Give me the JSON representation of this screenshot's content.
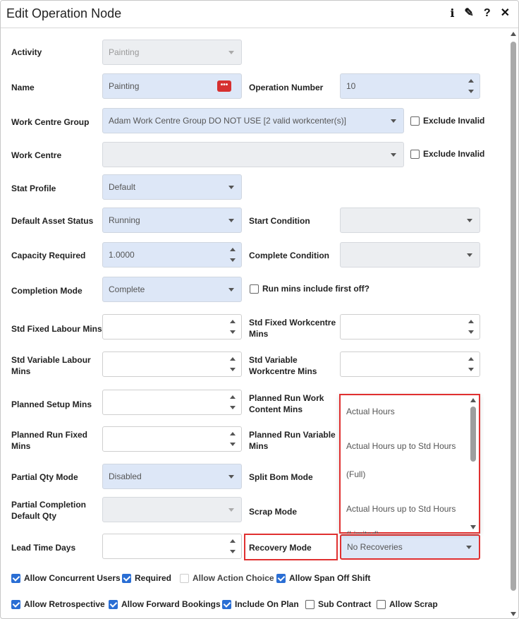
{
  "dialog": {
    "title": "Edit Operation Node",
    "icons": [
      "info-icon",
      "pencil-icon",
      "help-icon",
      "close-icon"
    ],
    "icon_glyphs": {
      "info": "i",
      "edit": "✎",
      "help": "?",
      "close": "✕"
    }
  },
  "form": {
    "activity": {
      "label": "Activity",
      "value": "Painting"
    },
    "name": {
      "label": "Name",
      "value": "Painting",
      "button": "•••"
    },
    "operation_number": {
      "label": "Operation Number",
      "value": "10"
    },
    "work_centre_group": {
      "label": "Work Centre Group",
      "value": "Adam Work Centre Group DO NOT USE [2 valid workcenter(s)]",
      "exclude_label": "Exclude Invalid"
    },
    "work_centre": {
      "label": "Work Centre",
      "value": "",
      "exclude_label": "Exclude Invalid"
    },
    "stat_profile": {
      "label": "Stat Profile",
      "value": "Default"
    },
    "default_asset_status": {
      "label": "Default Asset Status",
      "value": "Running"
    },
    "start_condition": {
      "label": "Start Condition",
      "value": ""
    },
    "capacity_required": {
      "label": "Capacity Required",
      "value": "1.0000"
    },
    "complete_condition": {
      "label": "Complete Condition",
      "value": ""
    },
    "completion_mode": {
      "label": "Completion Mode",
      "value": "Complete"
    },
    "run_mins_first_off": {
      "label": "Run mins include first off?"
    },
    "std_fixed_labour_mins": {
      "label": "Std Fixed Labour Mins",
      "value": ""
    },
    "std_fixed_workcentre_mins": {
      "label_line1": "Std Fixed Workcentre",
      "label_line2": "Mins",
      "value": ""
    },
    "std_variable_labour_mins": {
      "label_line1": "Std Variable Labour",
      "label_line2": "Mins",
      "value": ""
    },
    "std_variable_workcentre_mins": {
      "label_line1": "Std Variable",
      "label_line2": "Workcentre Mins",
      "value": ""
    },
    "planned_setup_mins": {
      "label": "Planned Setup Mins",
      "value": ""
    },
    "planned_run_work_content_mins": {
      "label_line1": "Planned Run Work",
      "label_line2": "Content Mins"
    },
    "planned_run_fixed_mins": {
      "label_line1": "Planned Run Fixed",
      "label_line2": "Mins",
      "value": ""
    },
    "planned_run_variable_mins": {
      "label_line1": "Planned Run Variable",
      "label_line2": "Mins"
    },
    "partial_qty_mode": {
      "label": "Partial Qty Mode",
      "value": "Disabled"
    },
    "split_bom_mode": {
      "label": "Split Bom Mode"
    },
    "partial_completion_default_qty": {
      "label_line1": "Partial Completion",
      "label_line2": "Default Qty",
      "value": ""
    },
    "scrap_mode": {
      "label": "Scrap Mode"
    },
    "lead_time_days": {
      "label": "Lead Time Days",
      "value": ""
    },
    "recovery_mode": {
      "label": "Recovery Mode",
      "value": "No Recoveries"
    }
  },
  "recovery_dropdown": {
    "options": [
      "Actual Hours",
      "Actual Hours up to Std Hours",
      "(Full)",
      "Actual Hours up to Std Hours",
      "(Limited)"
    ]
  },
  "checkboxes": {
    "row1": [
      {
        "label": "Allow Concurrent Users",
        "checked": true,
        "disabled": false
      },
      {
        "label": "Required",
        "checked": true,
        "disabled": false
      },
      {
        "label": "Allow Action Choice",
        "checked": false,
        "disabled": true
      },
      {
        "label": "Allow Span Off Shift",
        "checked": true,
        "disabled": false
      }
    ],
    "row2": [
      {
        "label": "Allow Retrospective",
        "checked": true,
        "disabled": false
      },
      {
        "label": "Allow Forward Bookings",
        "checked": true,
        "disabled": false
      },
      {
        "label": "Include On Plan",
        "checked": true,
        "disabled": false
      },
      {
        "label": "Sub Contract",
        "checked": false,
        "disabled": false
      },
      {
        "label": "Allow Scrap",
        "checked": false,
        "disabled": false
      }
    ]
  },
  "colors": {
    "highlight": "#e03030",
    "field_bg": "#dde7f7",
    "check_blue": "#2a6ed4"
  }
}
